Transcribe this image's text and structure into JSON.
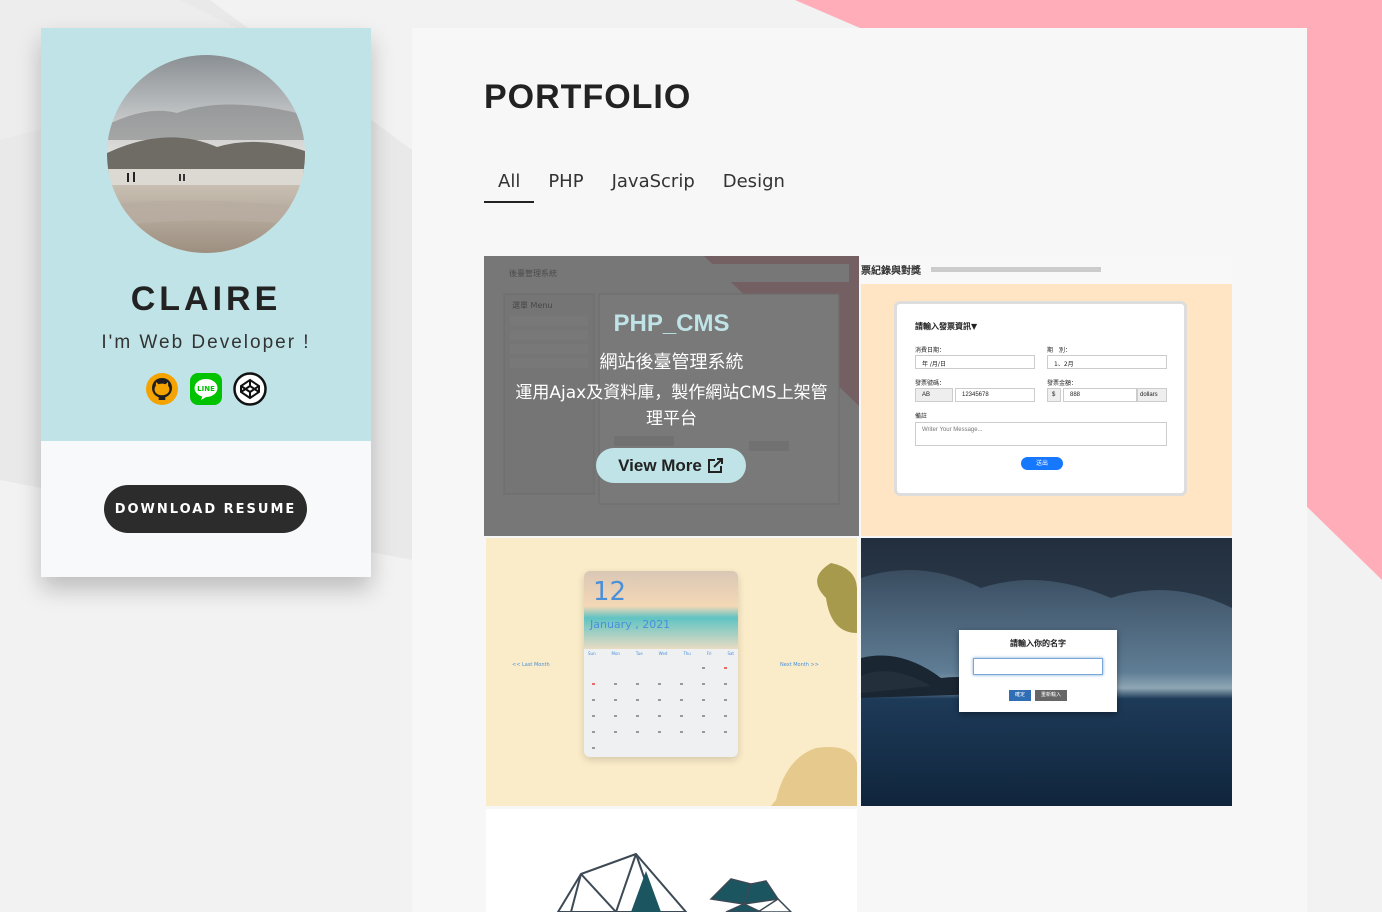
{
  "profile": {
    "name": "CLAIRE",
    "role": "I'm Web Developer !",
    "social_icons": [
      "github-icon",
      "line-icon",
      "codepen-icon"
    ],
    "resume_button": "DOWNLOAD RESUME"
  },
  "portfolio": {
    "title": "PORTFOLIO",
    "tabs": [
      {
        "label": "All",
        "active": true
      },
      {
        "label": "PHP",
        "active": false
      },
      {
        "label": "JavaScrip",
        "active": false
      },
      {
        "label": "Design",
        "active": false
      }
    ],
    "featured": {
      "title": "PHP_CMS",
      "subtitle": "網站後臺管理系統",
      "description": "運用Ajax及資料庫，製作網站CMS上架管理平台",
      "button": "View More"
    },
    "invoice_app": {
      "nav_title": "票紀錄與對獎",
      "form_title": "請輸入發票資訊▼",
      "date_label": "消費日期：",
      "date_value": "年 /月/日",
      "period_label": "期　別：",
      "period_value": "1、2月",
      "number_label": "發票號碼：",
      "number_prefix": "AB",
      "number_value": "12345678",
      "amount_label": "發票金額：",
      "amount_prefix": "$",
      "amount_value": "888",
      "amount_suffix": "dollars",
      "note_label": "備註",
      "note_placeholder": "Writer Your Message...",
      "submit": "送出"
    },
    "calendar_app": {
      "day": "12",
      "month_year": "January , 2021",
      "prev": "<< Last Month",
      "next": "Next Month >>",
      "weekdays": [
        "Sun",
        "Mon",
        "Tue",
        "Wed",
        "Thu",
        "Fri",
        "Sat"
      ]
    },
    "name_app": {
      "prompt": "請輸入你的名字",
      "ok": "確定",
      "reset": "重新輸入"
    }
  },
  "colors": {
    "accent": "#bfe3e6",
    "pink": "#ffadb9",
    "dark": "#2c2c2c"
  }
}
